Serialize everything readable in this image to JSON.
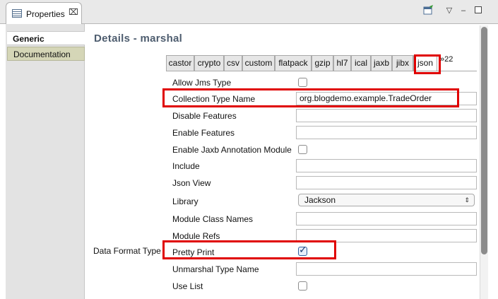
{
  "view": {
    "tab_label": "Properties",
    "close_glyph": "⌧",
    "toolbar": {
      "menu_glyph": "▽",
      "minimize_glyph": "‒"
    }
  },
  "sidebar": {
    "items": [
      {
        "label": "Generic",
        "selected": true
      },
      {
        "label": "Documentation",
        "selected": false
      }
    ]
  },
  "details": {
    "title": "Details - marshal"
  },
  "format_tabs": {
    "items": [
      "castor",
      "crypto",
      "csv",
      "custom",
      "flatpack",
      "gzip",
      "hl7",
      "ical",
      "jaxb",
      "jibx",
      "json"
    ],
    "active": "json",
    "overflow_count": "»22"
  },
  "form": {
    "group_label": "Data Format Type",
    "fields": {
      "allow_jms_type": {
        "label": "Allow Jms Type",
        "checked": false
      },
      "collection_type_name": {
        "label": "Collection Type Name",
        "value": "org.blogdemo.example.TradeOrder"
      },
      "disable_features": {
        "label": "Disable Features",
        "value": ""
      },
      "enable_features": {
        "label": "Enable Features",
        "value": ""
      },
      "enable_jaxb": {
        "label": "Enable Jaxb Annotation Module",
        "checked": false
      },
      "include": {
        "label": "Include",
        "value": ""
      },
      "json_view": {
        "label": "Json View",
        "value": ""
      },
      "library": {
        "label": "Library",
        "value": "Jackson",
        "arrows": "⇕"
      },
      "module_class_names": {
        "label": "Module Class Names",
        "value": ""
      },
      "module_refs": {
        "label": "Module Refs",
        "value": ""
      },
      "pretty_print": {
        "label": "Pretty Print",
        "checked": true
      },
      "unmarshal_type_name": {
        "label": "Unmarshal Type Name",
        "value": ""
      },
      "use_list": {
        "label": "Use List",
        "checked": false
      }
    }
  },
  "colors": {
    "highlight": "#e00000",
    "title": "#4e5d6f",
    "doc_tab": "#d5d6b7"
  }
}
